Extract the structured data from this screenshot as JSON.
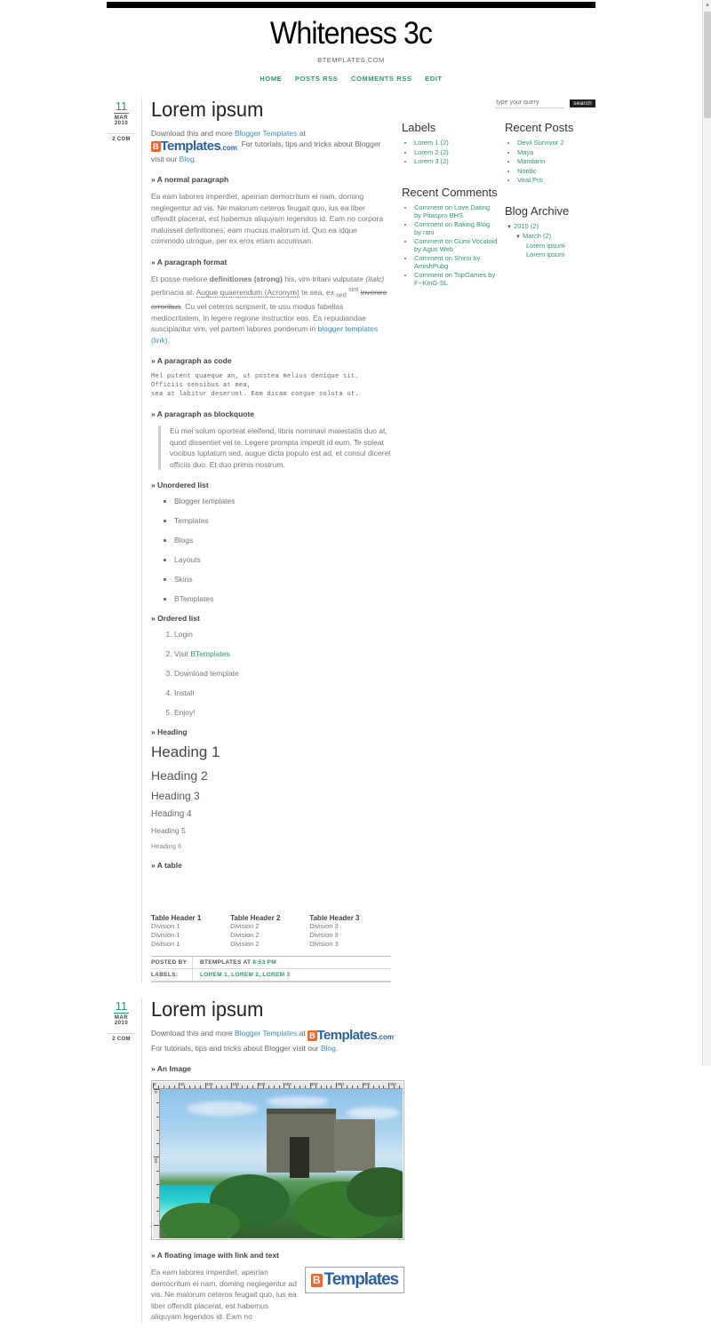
{
  "site": {
    "title": "Whiteness 3c",
    "description": "BTEMPLATES.COM",
    "nav": [
      "HOME",
      "POSTS RSS",
      "COMMENTS RSS",
      "EDIT"
    ]
  },
  "search": {
    "placeholder": "type your query",
    "value": "",
    "button": "search"
  },
  "posts": [
    {
      "date": {
        "day": "11",
        "month": "MAR",
        "year": "2010",
        "comments": "2 COM"
      },
      "title": "Lorem ipsum",
      "intro_1": "Download this and more ",
      "intro_link_1": "Blogger Templates",
      "intro_2": " at ",
      "logo_b": "B",
      "logo_t": "Templates",
      "logo_com": ".com",
      "intro_3": ". For tutorials, tips and tricks about Blogger visit our ",
      "intro_link_2": "Blog",
      "intro_4": ".",
      "sections": {
        "normal_paragraph": "» A normal paragraph",
        "normal_paragraph_text": "Ea eam labores imperdiet, apeirian democritum ei nam, doming neglegentur ad vis. Ne malorum ceteros feugait quo, ius ea liber offendit placerat, est habemus aliquyam legendos id. Eam no corpora maluisset definitiones, eam mucius malorum id. Quo ea idque commodo utroque, per ex eros etiam accumsan.",
        "paragraph_format": "» A paragraph format",
        "pf_1": "Et posse meliore ",
        "pf_strong": "definitiones (strong)",
        "pf_2": " his, vim tritani vulputate ",
        "pf_italic": "(italc)",
        "pf_3": " pertinacia at. ",
        "pf_acronym": "Augue quaerendum (Acronym)",
        "pf_4": " te sea, ex ",
        "pf_sub": "sed",
        "pf_sup": "sint",
        "pf_strike": "invenire erroribus",
        "pf_5": ". Cu vel ceteros scripserit, te usu modus fabellas mediocritatem. In legere regione instructior eos. Ea repudiandae suscipiantur vim, vel partem labores ponderum in ",
        "pf_link": "blogger templates (link)",
        "pf_6": ".",
        "paragraph_code": "» A paragraph as code",
        "code_text": "Mel putent quaeque an, ut postea melius denique sit. Officiis sensibus at mea,\nsea at labitur deserunt. Eam dicam congue soluta ut.",
        "paragraph_blockquote": "» A paragraph as blockquote",
        "blockquote_text": "Eu mei solum oporteat eleifend, libris nominavi maiestatis duo at, quod dissentiet vel te. Legere prompta impedit id eum. Te soleat vocibus luptatum sed, augue dicta populo est ad, et consul diceret officiis duo. Et duo primis nostrum.",
        "unordered_list": "» Unordered list",
        "ul_items": [
          "Blogger templates",
          "Templates",
          "Blogs",
          "Layouts",
          "Skins",
          "BTemplates"
        ],
        "ordered_list": "» Ordered list",
        "ol_items": [
          {
            "text": "Login",
            "link": ""
          },
          {
            "text": "Visit ",
            "link": "BTemplates"
          },
          {
            "text": "Download template",
            "link": ""
          },
          {
            "text": "Install",
            "link": ""
          },
          {
            "text": "Enjoy!",
            "link": ""
          }
        ],
        "heading_label": "» Heading",
        "headings": [
          "Heading 1",
          "Heading 2",
          "Heading 3",
          "Heading 4",
          "Heading 5",
          "Heading 6"
        ],
        "table_label": "» A table",
        "table": {
          "headers": [
            "Table Header 1",
            "Table Header 2",
            "Table Header 3"
          ],
          "rows": [
            [
              "Division 1",
              "Division 2",
              "Division 3"
            ],
            [
              "Division 1",
              "Division 2",
              "Division 3"
            ],
            [
              "Division 1",
              "Division 2",
              "Division 3"
            ]
          ]
        }
      },
      "meta": {
        "posted_by_label": "POSTED BY",
        "author": "BTEMPLATES AT ",
        "time": "8:53 PM",
        "labels_label": "LABELS:",
        "labels": "LOREM 1, LOREM 2, LOREM 3"
      }
    },
    {
      "date": {
        "day": "11",
        "month": "MAR",
        "year": "2010",
        "comments": "2 COM"
      },
      "title": "Lorem ipsum",
      "intro_1": "Download this and more ",
      "intro_link_1": "Blogger Templates",
      "intro_2": " at ",
      "logo_b": "B",
      "logo_t": "Templates",
      "logo_com": ".com",
      "intro_3": ". For tutorials, tips and tricks about Blogger visit our ",
      "intro_link_2": "Blog",
      "intro_4": ".",
      "sections": {
        "image_label": "» An Image",
        "image_alt": "mayan-ruin-by-the-sea-photo",
        "ruler_ticks": [
          "0",
          "50",
          "100",
          "150",
          "200",
          "250",
          "300",
          "350",
          "400",
          "450"
        ],
        "ruler_v_ticks": [
          "0",
          "50"
        ],
        "float_label": "» A floating image with link and text",
        "float_text": "Ea eam labores imperdiet, apeirian democritum ei nam, doming neglegentur ad vis. Ne malorum ceteros feugait quo, ius ea liber offendit placerat, est habemus aliquyam legendos id. Eam no",
        "float_logo_b": "B",
        "float_logo_t": "Templates"
      }
    }
  ],
  "sidebar": {
    "labels": {
      "title": "Labels",
      "items": [
        "Lorem 1 (2)",
        "Lorem 2 (2)",
        "Lorem 3 (2)"
      ]
    },
    "recent_comments": {
      "title": "Recent Comments",
      "items": [
        "Comment on Love Dating by Pitaspro BHS",
        "Comment on Baking Blog by rani",
        "Comment on Gumi Vocaloid by Agus Web",
        "Comment on Shiroi by AmishPubg",
        "Comment on TopGames by F--KinG-SL"
      ]
    },
    "recent_posts": {
      "title": "Recent Posts",
      "items": [
        "Devil Survivor 2",
        "Maya",
        "Mandarin",
        "Nordic",
        "Viral Pro"
      ]
    },
    "blog_archive": {
      "title": "Blog Archive",
      "year": "2010 (2)",
      "month": "March (2)",
      "entries": [
        "Lorem ipsum",
        "Lorem ipsum"
      ],
      "expand_glyph": "▼"
    }
  },
  "colors": {
    "accent_green": "#2e9478",
    "link_blue": "#3d8fb5",
    "logo_orange": "#eb6a2b",
    "logo_blue": "#2b5f9e",
    "text_gray": "#777777"
  }
}
